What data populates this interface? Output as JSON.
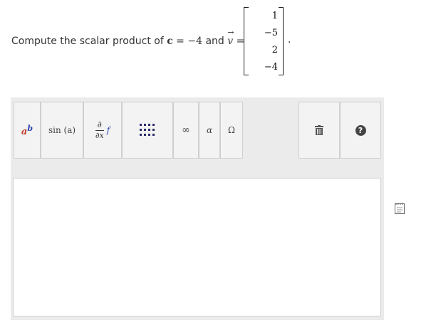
{
  "problem": {
    "prompt_prefix": "Compute the scalar product of ",
    "c_var": "c",
    "equals": " = ",
    "c_value": "−4",
    "and_text": " and ",
    "v_var": "v",
    "v_arrow": "→",
    "vector": [
      "1",
      "−5",
      "2",
      "−4"
    ],
    "period": "."
  },
  "toolbar": {
    "power_base": "a",
    "power_exp": "b",
    "sin_label": "sin (a)",
    "partial_top": "∂",
    "partial_bottom": "∂x",
    "partial_f": "f",
    "infinity": "∞",
    "alpha": "α",
    "omega": "Ω",
    "help": "?"
  },
  "answer": {
    "value": ""
  },
  "colors": {
    "power_base": "#c0392b",
    "power_exp": "#2a3eb1",
    "accent": "#444444"
  }
}
